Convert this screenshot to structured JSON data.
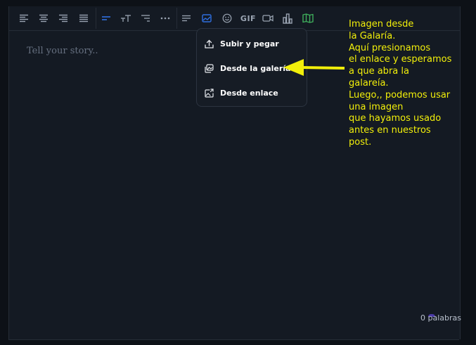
{
  "editor": {
    "placeholder": "Tell your story..",
    "word_count": "0 palabras"
  },
  "toolbar": {
    "buttons": [
      {
        "name": "align-left-icon"
      },
      {
        "name": "align-center-icon"
      },
      {
        "name": "align-right-icon"
      },
      {
        "name": "align-justify-icon"
      },
      {
        "name": "heading-icon"
      },
      {
        "name": "text-size-icon"
      },
      {
        "name": "list-icon"
      },
      {
        "name": "more-icon"
      },
      {
        "name": "paragraph-icon"
      },
      {
        "name": "image-icon"
      },
      {
        "name": "emoji-icon"
      },
      {
        "name": "gif-icon"
      },
      {
        "name": "video-icon"
      },
      {
        "name": "chart-icon"
      },
      {
        "name": "map-icon"
      }
    ],
    "gif_label": "GIF",
    "accent_color": "#2f6fe0",
    "map_color": "#3fae5c"
  },
  "image_menu": {
    "items": [
      {
        "label": "Subir y pegar",
        "icon": "upload-icon"
      },
      {
        "label": "Desde la galería",
        "icon": "gallery-icon"
      },
      {
        "label": "Desde enlace",
        "icon": "link-image-icon"
      }
    ]
  },
  "annotation": {
    "color": "#f2ef0a",
    "lines": [
      "Imagen desde",
      "la Galaría.",
      "Aquí presionamos",
      "el enlace y esperamos",
      "a que abra la",
      "galareía.",
      "Luego,, podemos usar",
      "una imagen",
      "que hayamos usado",
      "antes en nuestros",
      "post."
    ]
  }
}
